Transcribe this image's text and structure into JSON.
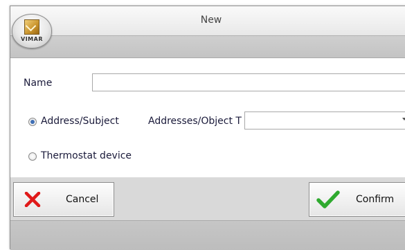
{
  "window": {
    "title": "New"
  },
  "logo": {
    "text": "VIMAR"
  },
  "form": {
    "name_label": "Name",
    "name_value": "",
    "address_radio_label": "Address/Subject",
    "address_radio_checked": true,
    "objects_label": "Addresses/Object T",
    "objects_value": "",
    "thermostat_radio_label": "Thermostat device",
    "thermostat_radio_checked": false
  },
  "buttons": {
    "cancel_label": "Cancel",
    "confirm_label": "Confirm"
  },
  "icons": {
    "cancel": "x-icon",
    "confirm": "check-icon"
  },
  "colors": {
    "cancel_icon": "#e01a1a",
    "confirm_icon": "#2faa2f",
    "radio_selected": "#3f6fb5"
  }
}
